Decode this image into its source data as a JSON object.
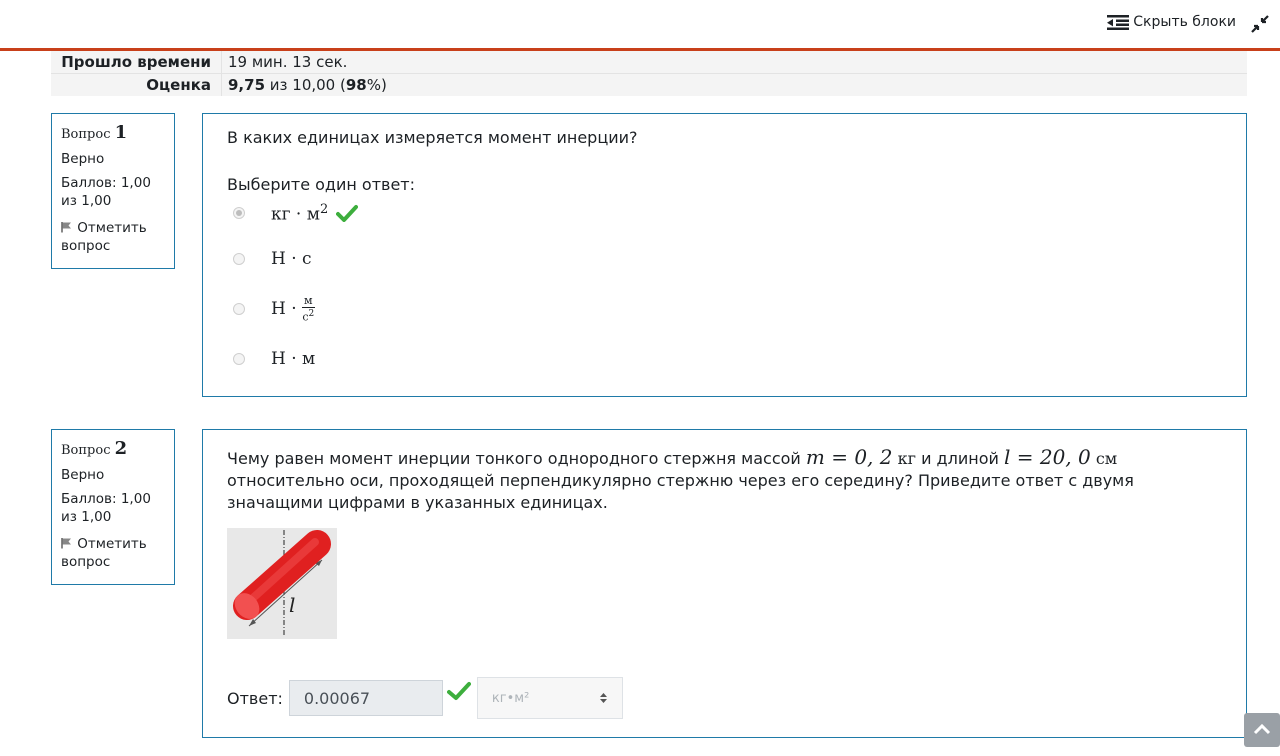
{
  "header": {
    "hide_blocks_label": "Скрыть блоки"
  },
  "summary": {
    "time_label": "Прошло времени",
    "time_value": "19 мин. 13 сек.",
    "grade_label": "Оценка",
    "grade_score": "9,75",
    "grade_of": " из 10,00 (",
    "grade_percent": "98",
    "grade_tail": "%)"
  },
  "questions": [
    {
      "label": "Вопрос ",
      "number": "1",
      "state": "Верно",
      "grade": "Баллов: 1,00 из 1,00",
      "flag": "Отметить вопрос",
      "text": "В каких единицах измеряется момент инерции?",
      "prompt": "Выберите один ответ:",
      "options": [
        {
          "text": "кг · м",
          "sup": "2"
        },
        {
          "text": "Н · с"
        },
        {
          "text": "Н · ",
          "frac_num": "м",
          "frac_den": "с",
          "frac_den_sup": "2"
        },
        {
          "text": "Н · м"
        }
      ]
    },
    {
      "label": "Вопрос ",
      "number": "2",
      "state": "Верно",
      "grade": "Баллов: 1,00 из 1,00",
      "flag": "Отметить вопрос",
      "text_a": "Чему равен момент инерции тонкого однородного стержня массой ",
      "mass_formula": "m = 0, 2",
      "mass_unit": "кг",
      "text_b": " и длиной ",
      "length_formula": "l = 20, 0",
      "length_unit": "см",
      "text_c": "относительно оси, проходящей перпендикулярно стержню через его середину? Приведите ответ с двумя значащими цифрами в указанных единицах.",
      "figure_label": "l",
      "answer_label": "Ответ:",
      "answer_value": "0.00067",
      "unit_selected": "кг•м²"
    }
  ],
  "colors": {
    "accent_line": "#c8401a",
    "border": "#1f7aa8",
    "check": "#3dae3d"
  },
  "icons": [
    "hide-blocks-icon",
    "collapse-icon",
    "check-icon",
    "flag-icon",
    "arrow-up-icon",
    "updown-icon"
  ]
}
